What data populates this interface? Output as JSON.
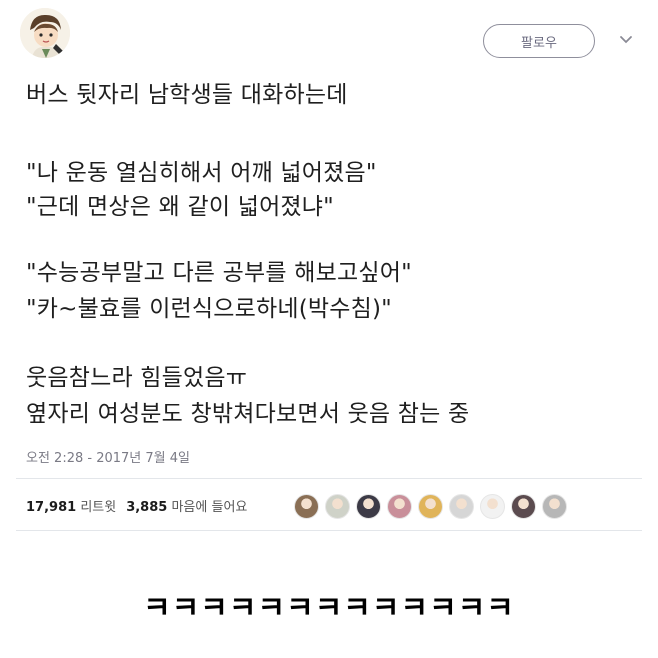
{
  "header": {
    "follow_label": "팔로우",
    "avatar_icon": "user-avatar-cartoon",
    "menu_icon": "chevron-down-icon"
  },
  "tweet": {
    "lines": [
      "버스 뒷자리 남학생들 대화하는데",
      "\"나 운동 열심히해서 어깨 넓어졌음\"",
      "\"근데 면상은 왜 같이 넓어졌냐\"",
      "\"수능공부말고 다른 공부를 해보고싶어\"",
      "\"카~불효를 이런식으로하네(박수침)\"",
      "웃음참느라 힘들었음ㅠ",
      "옆자리 여성분도 창밖쳐다보면서 웃음 참는 중"
    ],
    "timestamp": "오전 2:28 - 2017년 7월 4일"
  },
  "stats": {
    "retweet_count": "17,981",
    "retweet_label": "리트윗",
    "like_count": "3,885",
    "like_label": "마음에 들어요"
  },
  "likers": [
    {
      "color": "#8a6f55"
    },
    {
      "color": "#cfd2c8"
    },
    {
      "color": "#3c3a46"
    },
    {
      "color": "#c98f9a"
    },
    {
      "color": "#e0b45a"
    },
    {
      "color": "#d6d6d6"
    },
    {
      "color": "#f2f2f2"
    },
    {
      "color": "#5b4b4f"
    },
    {
      "color": "#b7b7b7"
    }
  ],
  "caption": "ㅋㅋㅋㅋㅋㅋㅋㅋㅋㅋㅋㅋㅋ"
}
